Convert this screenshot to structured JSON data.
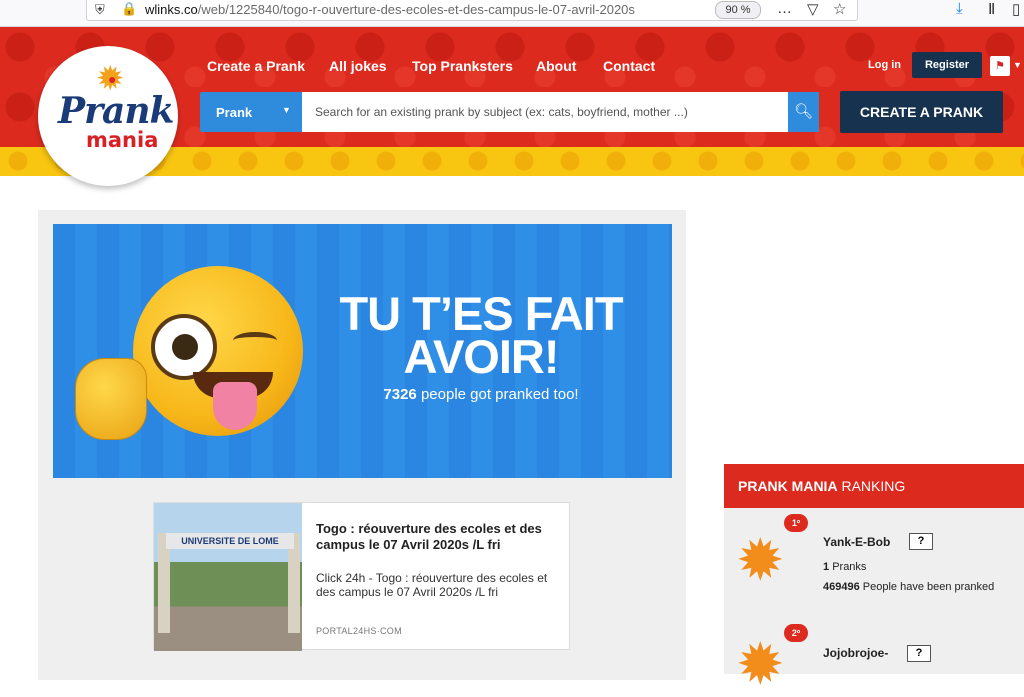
{
  "browser": {
    "url_domain": "wlinks.co",
    "url_path": "/web/1225840/togo-r-ouverture-des-ecoles-et-des-campus-le-07-avril-2020s",
    "zoom": "90 %"
  },
  "logo": {
    "line1": "Prank",
    "line2": "mania"
  },
  "nav": {
    "items": [
      "Create a Prank",
      "All jokes",
      "Top Pranksters",
      "About",
      "Contact"
    ],
    "login": "Log in",
    "register": "Register"
  },
  "search": {
    "category": "Prank",
    "placeholder": "Search for an existing prank by subject (ex: cats, boyfriend, mother ...)",
    "create_label": "CREATE A PRANK"
  },
  "banner": {
    "title": "TU T’ES FAIT AVOIR!",
    "count": "7326",
    "count_suffix": "people got pranked too!"
  },
  "news": {
    "image_sign": "UNIVERSITE DE LOME",
    "title": "Togo : réouverture des ecoles et des campus le 07 Avril 2020s /L fri",
    "description": "Click 24h - Togo : réouverture des ecoles et des campus le 07 Avril 2020s /L fri",
    "source": "PORTAL24HS·COM"
  },
  "ranking": {
    "title_bold": "PRANK MANIA",
    "title_rest": "RANKING",
    "entries": [
      {
        "rank": "1º",
        "name": "Yank-E-Bob",
        "badge": "?",
        "pranks_count": "1",
        "pranks_label": "Pranks",
        "people_count": "469496",
        "people_label": "People have been pranked"
      },
      {
        "rank": "2º",
        "name": "Jojobrojoe-",
        "badge": "?"
      }
    ]
  },
  "colors": {
    "header_red": "#dd2a1f",
    "accent_blue": "#2f8bdc",
    "navy": "#16324f",
    "yellow": "#f8c510"
  }
}
